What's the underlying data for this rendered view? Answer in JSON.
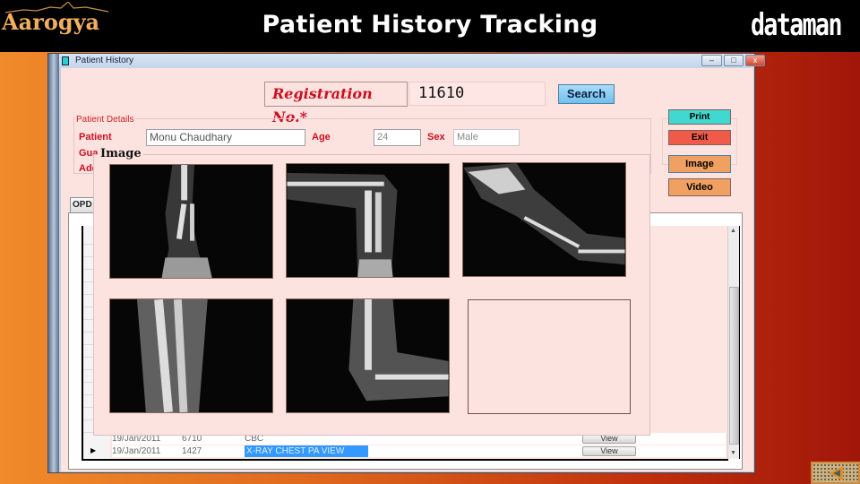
{
  "header": {
    "logo_left": "Aarogya",
    "title": "Patient History Tracking",
    "logo_right": "dataman"
  },
  "window": {
    "title": "Patient History",
    "controls": {
      "minimize": "–",
      "maximize": "□",
      "close": "x"
    }
  },
  "registration": {
    "label": "Registration No.*",
    "value": "11610",
    "search_label": "Search"
  },
  "patient_details": {
    "legend": "Patient Details",
    "patient_label": "Patient",
    "patient_value": "Monu Chaudhary",
    "age_label": "Age",
    "age_value": "24",
    "sex_label": "Sex",
    "sex_value": "Male",
    "guardian_label": "Gua",
    "address_label": "Add"
  },
  "actions": {
    "print": "Print",
    "exit": "Exit",
    "image": "Image",
    "video": "Video",
    "colors": {
      "print": "#40d8d0",
      "exit": "#f05a48",
      "media": "#f0a060"
    }
  },
  "tabs": [
    {
      "label": "OPD"
    }
  ],
  "records": [
    {
      "date": "19/Jan/2011",
      "id": "6710",
      "test": "CBC",
      "action": "View",
      "selected": false
    },
    {
      "date": "19/Jan/2011",
      "id": "1427",
      "test": "X-RAY CHEST PA VIEW",
      "action": "View",
      "selected": true
    }
  ],
  "image_popup": {
    "title": "Image",
    "thumbnails": [
      {
        "label": "xray-forearm-fracture-ap",
        "empty": false
      },
      {
        "label": "xray-forearm-fracture-bent",
        "empty": false
      },
      {
        "label": "xray-hand-forearm-lateral",
        "empty": false
      },
      {
        "label": "xray-forearm-closeup",
        "empty": false
      },
      {
        "label": "xray-elbow-forearm",
        "empty": false
      },
      {
        "label": "empty-slot",
        "empty": true
      }
    ]
  },
  "nav": {
    "prev_label": "previous-slide"
  },
  "colors": {
    "accent_red": "#cc1020",
    "selection_blue": "#3399ff",
    "search_blue": "#80c8f0"
  }
}
